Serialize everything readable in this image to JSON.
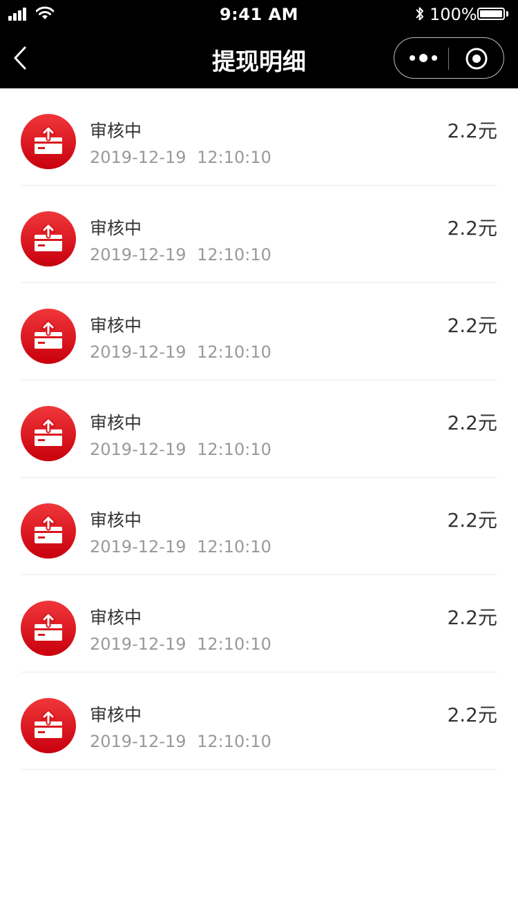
{
  "status_bar": {
    "time": "9:41 AM",
    "battery": "100%"
  },
  "nav": {
    "title": "提现明细"
  },
  "colors": {
    "nav_bg": "#000000",
    "icon_red": "#e0262b"
  },
  "records": [
    {
      "status": "审核中",
      "date": "2019-12-19",
      "time": "12:10:10",
      "amount": "2.2元"
    },
    {
      "status": "审核中",
      "date": "2019-12-19",
      "time": "12:10:10",
      "amount": "2.2元"
    },
    {
      "status": "审核中",
      "date": "2019-12-19",
      "time": "12:10:10",
      "amount": "2.2元"
    },
    {
      "status": "审核中",
      "date": "2019-12-19",
      "time": "12:10:10",
      "amount": "2.2元"
    },
    {
      "status": "审核中",
      "date": "2019-12-19",
      "time": "12:10:10",
      "amount": "2.2元"
    },
    {
      "status": "审核中",
      "date": "2019-12-19",
      "time": "12:10:10",
      "amount": "2.2元"
    },
    {
      "status": "审核中",
      "date": "2019-12-19",
      "time": "12:10:10",
      "amount": "2.2元"
    }
  ]
}
